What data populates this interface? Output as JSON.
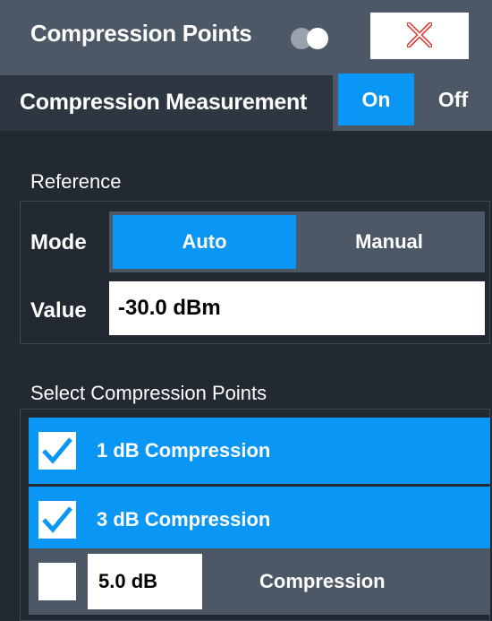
{
  "dialog": {
    "title": "Compression Points",
    "toggle_icon": "toggle-icon",
    "close_icon": "close-x-icon"
  },
  "compression_measurement": {
    "label": "Compression Measurement",
    "on_label": "On",
    "off_label": "Off",
    "selected": "On"
  },
  "reference": {
    "section_label": "Reference",
    "mode_label": "Mode",
    "mode_auto": "Auto",
    "mode_manual": "Manual",
    "mode_selected": "Auto",
    "value_label": "Value",
    "value": "-30.0 dBm"
  },
  "select_points": {
    "section_label": "Select Compression Points",
    "items": [
      {
        "label": "1 dB Compression",
        "checked": true
      },
      {
        "label": "3 dB Compression",
        "checked": true
      },
      {
        "value": "5.0 dB",
        "label": "Compression",
        "checked": false
      }
    ]
  },
  "colors": {
    "accent": "#0a96f4",
    "title_bar": "#4c5866",
    "background": "#222931",
    "close_icon": "#e0302a"
  }
}
